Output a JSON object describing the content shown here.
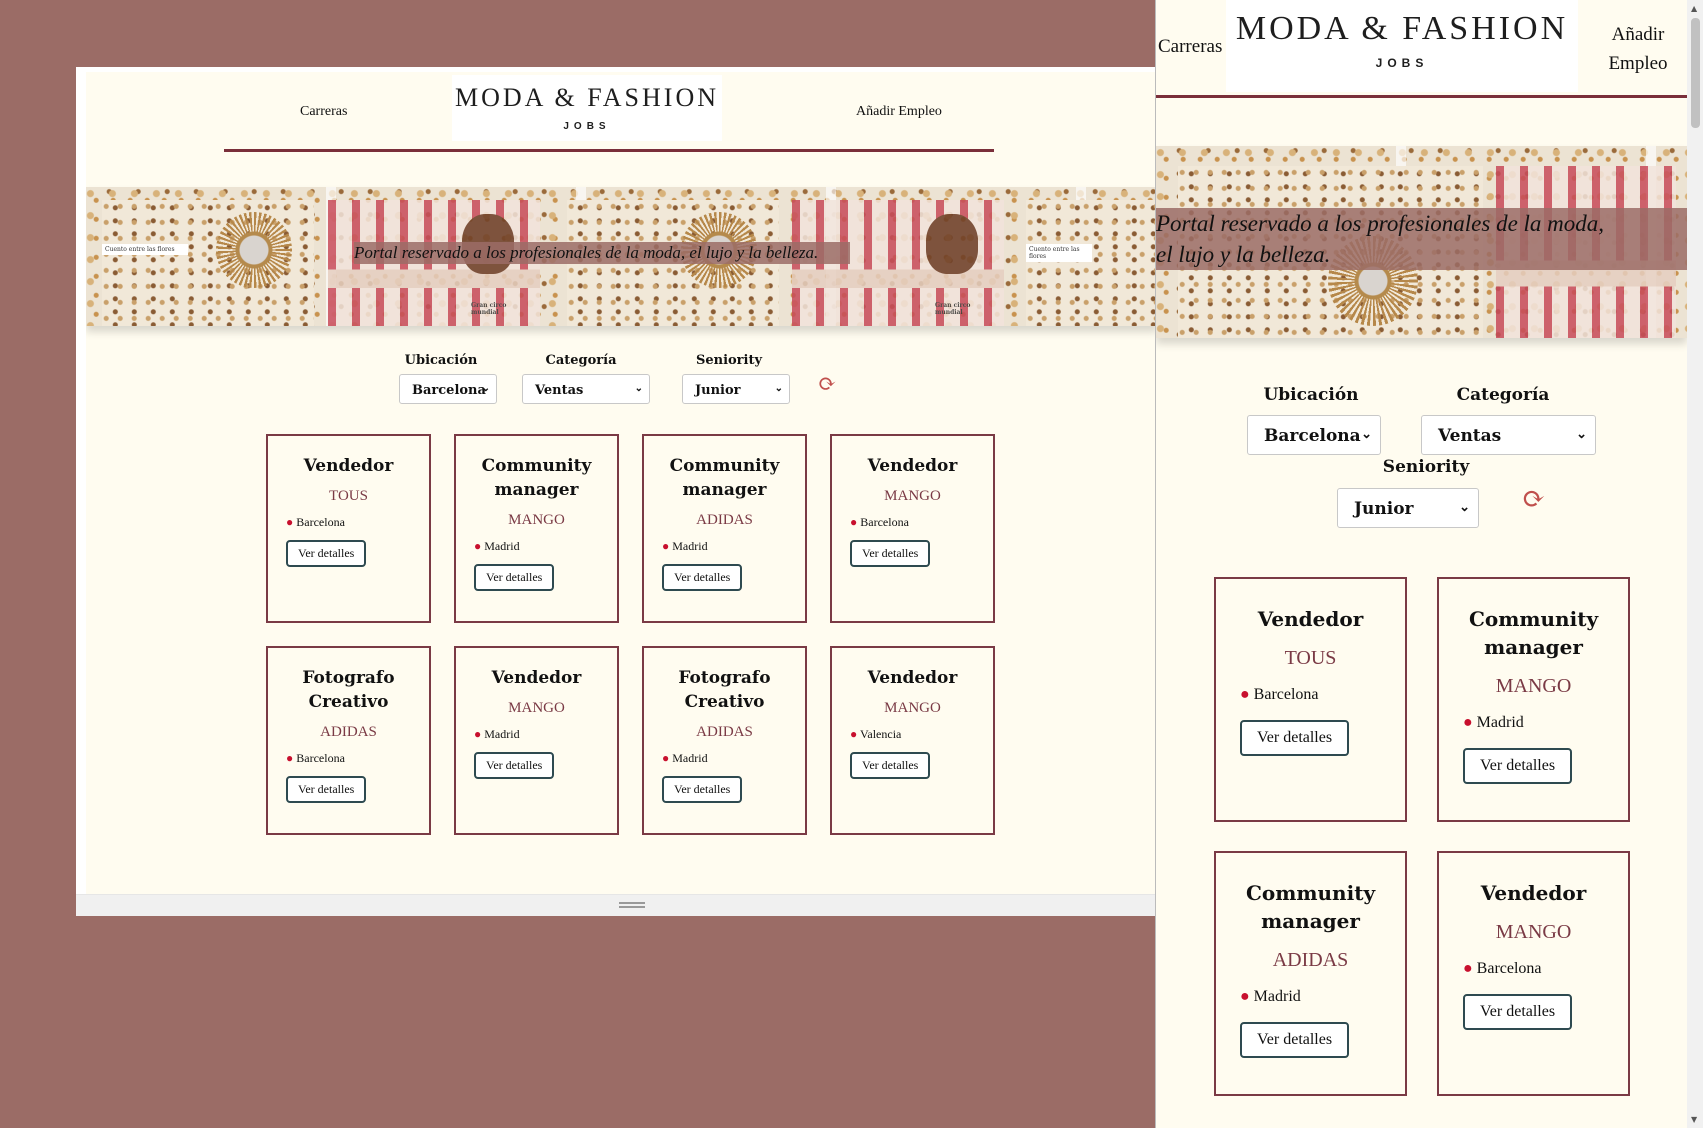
{
  "nav": {
    "careers": "Carreras",
    "add_job": "Añadir Empleo",
    "add_job_line1": "Añadir",
    "add_job_line2": "Empleo",
    "logo_main": "MODA & FASHION",
    "logo_sub": "JOBS"
  },
  "hero": {
    "tagline": "Portal reservado a los profesionales de la moda, el lujo y la belleza.",
    "tagline_line1": "Portal reservado a los profesionales de la moda,",
    "tagline_line2": "el lujo y la belleza.",
    "magazine_caption": "Cuento entre las flores",
    "magazine_caption2": "Gran circo mundial"
  },
  "filters": {
    "location_label": "Ubicación",
    "location_value": "Barcelona",
    "category_label": "Categoría",
    "category_value": "Ventas",
    "seniority_label": "Seniority",
    "seniority_value": "Junior"
  },
  "jobs": [
    {
      "title": "Vendedor",
      "company": "TOUS",
      "location": "Barcelona",
      "button": "Ver detalles"
    },
    {
      "title": "Community manager",
      "company": "MANGO",
      "location": "Madrid",
      "button": "Ver detalles"
    },
    {
      "title": "Community manager",
      "company": "ADIDAS",
      "location": "Madrid",
      "button": "Ver detalles"
    },
    {
      "title": "Vendedor",
      "company": "MANGO",
      "location": "Barcelona",
      "button": "Ver detalles"
    },
    {
      "title": "Fotografo Creativo",
      "company": "ADIDAS",
      "location": "Barcelona",
      "button": "Ver detalles"
    },
    {
      "title": "Vendedor",
      "company": "MANGO",
      "location": "Madrid",
      "button": "Ver detalles"
    },
    {
      "title": "Fotografo Creativo",
      "company": "ADIDAS",
      "location": "Madrid",
      "button": "Ver detalles"
    },
    {
      "title": "Vendedor",
      "company": "MANGO",
      "location": "Valencia",
      "button": "Ver detalles"
    }
  ],
  "colors": {
    "background": "#9b6c66",
    "page": "#fffcf0",
    "accent": "#7a3a45",
    "pin": "#c8102e"
  }
}
